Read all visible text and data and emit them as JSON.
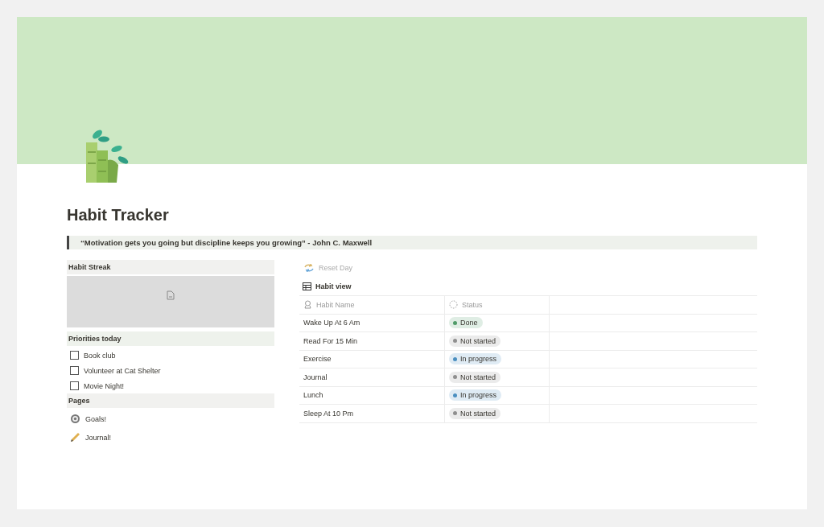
{
  "page": {
    "title": "Habit Tracker",
    "quote": "“Motivation gets you going but discipline keeps you growing” - John C. Maxwell"
  },
  "habit_streak": {
    "heading": "Habit Streak"
  },
  "priorities": {
    "heading": "Priorities today",
    "items": [
      {
        "label": "Book club",
        "checked": false
      },
      {
        "label": "Volunteer at Cat Shelter",
        "checked": false
      },
      {
        "label": "Movie Night!",
        "checked": false
      }
    ]
  },
  "pages": {
    "heading": "Pages",
    "items": [
      {
        "label": "Goals!",
        "kind": "target"
      },
      {
        "label": "Journal!",
        "kind": "pencil"
      }
    ]
  },
  "reset_button": {
    "label": "Reset Day"
  },
  "view": {
    "label": "Habit view"
  },
  "table": {
    "columns": [
      "Habit Name",
      "Status"
    ],
    "rows": [
      {
        "name": "Wake Up At 6 Am",
        "status": "Done",
        "color": "#4f9b68"
      },
      {
        "name": "Read For 15 Min",
        "status": "Not started",
        "color": "#8f8f8f"
      },
      {
        "name": "Exercise",
        "status": "In progress",
        "color": "#4b8fc0"
      },
      {
        "name": "Journal",
        "status": "Not started",
        "color": "#8f8f8f"
      },
      {
        "name": "Lunch",
        "status": "In progress",
        "color": "#4b8fc0"
      },
      {
        "name": "Sleep At 10 Pm",
        "status": "Not started",
        "color": "#8f8f8f"
      }
    ]
  }
}
